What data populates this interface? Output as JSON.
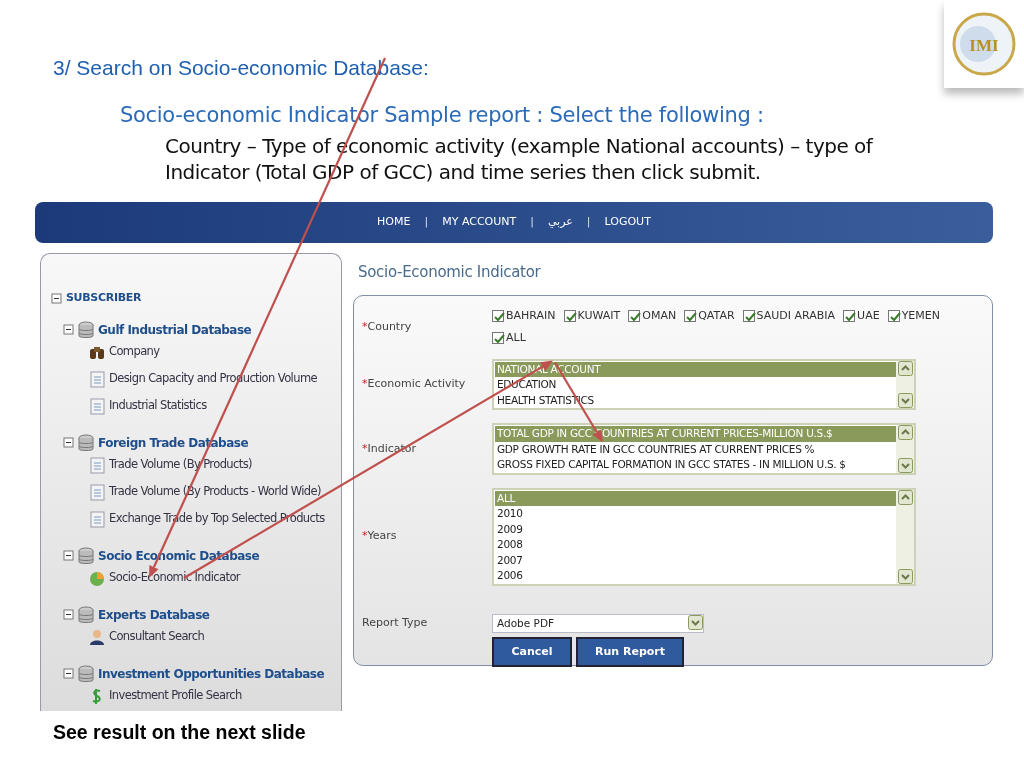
{
  "slide": {
    "heading": "3/ Search on Socio-economic Database:",
    "subheading": "Socio-economic Indicator Sample report : Select the following :",
    "body": "Country – Type of economic activity (example National accounts) – type of Indicator (Total GDP of GCC) and time series then click submit.",
    "footer": "See result on the next slide",
    "logo_text": "IMI"
  },
  "nav": [
    {
      "kind": "link",
      "label": "HOME"
    },
    {
      "kind": "separator",
      "label": "|"
    },
    {
      "kind": "link",
      "label": "MY ACCOUNT"
    },
    {
      "kind": "separator",
      "label": "|"
    },
    {
      "kind": "link",
      "label": "عربي"
    },
    {
      "kind": "separator",
      "label": "|"
    },
    {
      "kind": "link",
      "label": "LOGOUT"
    }
  ],
  "tree": {
    "label": "SUBSCRIBER",
    "expanded": true,
    "children": [
      {
        "label": "Gulf Industrial Database",
        "kind": "database",
        "expanded": true,
        "children": [
          {
            "label": "Company",
            "kind": "binoculars"
          },
          {
            "label": "Design Capacity and Production Volume",
            "kind": "report"
          },
          {
            "label": "Industrial Statistics",
            "kind": "report"
          }
        ]
      },
      {
        "label": "Foreign Trade Database",
        "kind": "database",
        "expanded": true,
        "children": [
          {
            "label": "Trade Volume (By Products)",
            "kind": "report"
          },
          {
            "label": "Trade Volume (By Products - World Wide)",
            "kind": "report"
          },
          {
            "label": "Exchange Trade by Top Selected Products",
            "kind": "report"
          }
        ]
      },
      {
        "label": "Socio Economic Database",
        "kind": "database",
        "expanded": true,
        "children": [
          {
            "label": "Socio-Economic Indicator",
            "kind": "pie"
          }
        ]
      },
      {
        "label": "Experts Database",
        "kind": "database",
        "expanded": true,
        "children": [
          {
            "label": "Consultant Search",
            "kind": "person"
          }
        ]
      },
      {
        "label": "Investment Opportunities Database",
        "kind": "database",
        "expanded": true,
        "children": [
          {
            "label": "Investment Profile Search",
            "kind": "dollar"
          }
        ]
      }
    ]
  },
  "form": {
    "title": "Socio-Economic Indicator",
    "required_mark": "*",
    "country": {
      "label": "Country",
      "required": true,
      "options": [
        {
          "label": "BAHRAIN",
          "checked": true
        },
        {
          "label": "KUWAIT",
          "checked": true
        },
        {
          "label": "OMAN",
          "checked": true
        },
        {
          "label": "QATAR",
          "checked": true
        },
        {
          "label": "SAUDI ARABIA",
          "checked": true
        },
        {
          "label": "UAE",
          "checked": true
        },
        {
          "label": "YEMEN",
          "checked": true
        },
        {
          "label": "ALL",
          "checked": true
        }
      ]
    },
    "lists": [
      {
        "label": "Economic Activity",
        "required": true,
        "items": [
          {
            "label": "NATIONAL ACCOUNT",
            "selected": true
          },
          {
            "label": "EDUCATION",
            "selected": false
          },
          {
            "label": "HEALTH STATISTICS",
            "selected": false
          }
        ]
      },
      {
        "label": "Indicator",
        "required": true,
        "items": [
          {
            "label": "TOTAL GDP IN GCC COUNTRIES AT CURRENT PRICES-MILLION U.S.$",
            "selected": true
          },
          {
            "label": "GDP GROWTH RATE IN GCC COUNTRIES AT CURRENT PRICES %",
            "selected": false
          },
          {
            "label": "GROSS FIXED CAPITAL FORMATION IN GCC STATES - IN MILLION U.S. $",
            "selected": false
          }
        ]
      },
      {
        "label": "Years",
        "required": true,
        "items": [
          {
            "label": "ALL",
            "selected": true
          },
          {
            "label": "2010",
            "selected": false
          },
          {
            "label": "2009",
            "selected": false
          },
          {
            "label": "2008",
            "selected": false
          },
          {
            "label": "2007",
            "selected": false
          },
          {
            "label": "2006",
            "selected": false
          }
        ]
      }
    ],
    "report_type": {
      "label": "Report Type",
      "required": false,
      "value": "Adobe PDF"
    },
    "buttons": [
      "Cancel",
      "Run Report"
    ]
  }
}
